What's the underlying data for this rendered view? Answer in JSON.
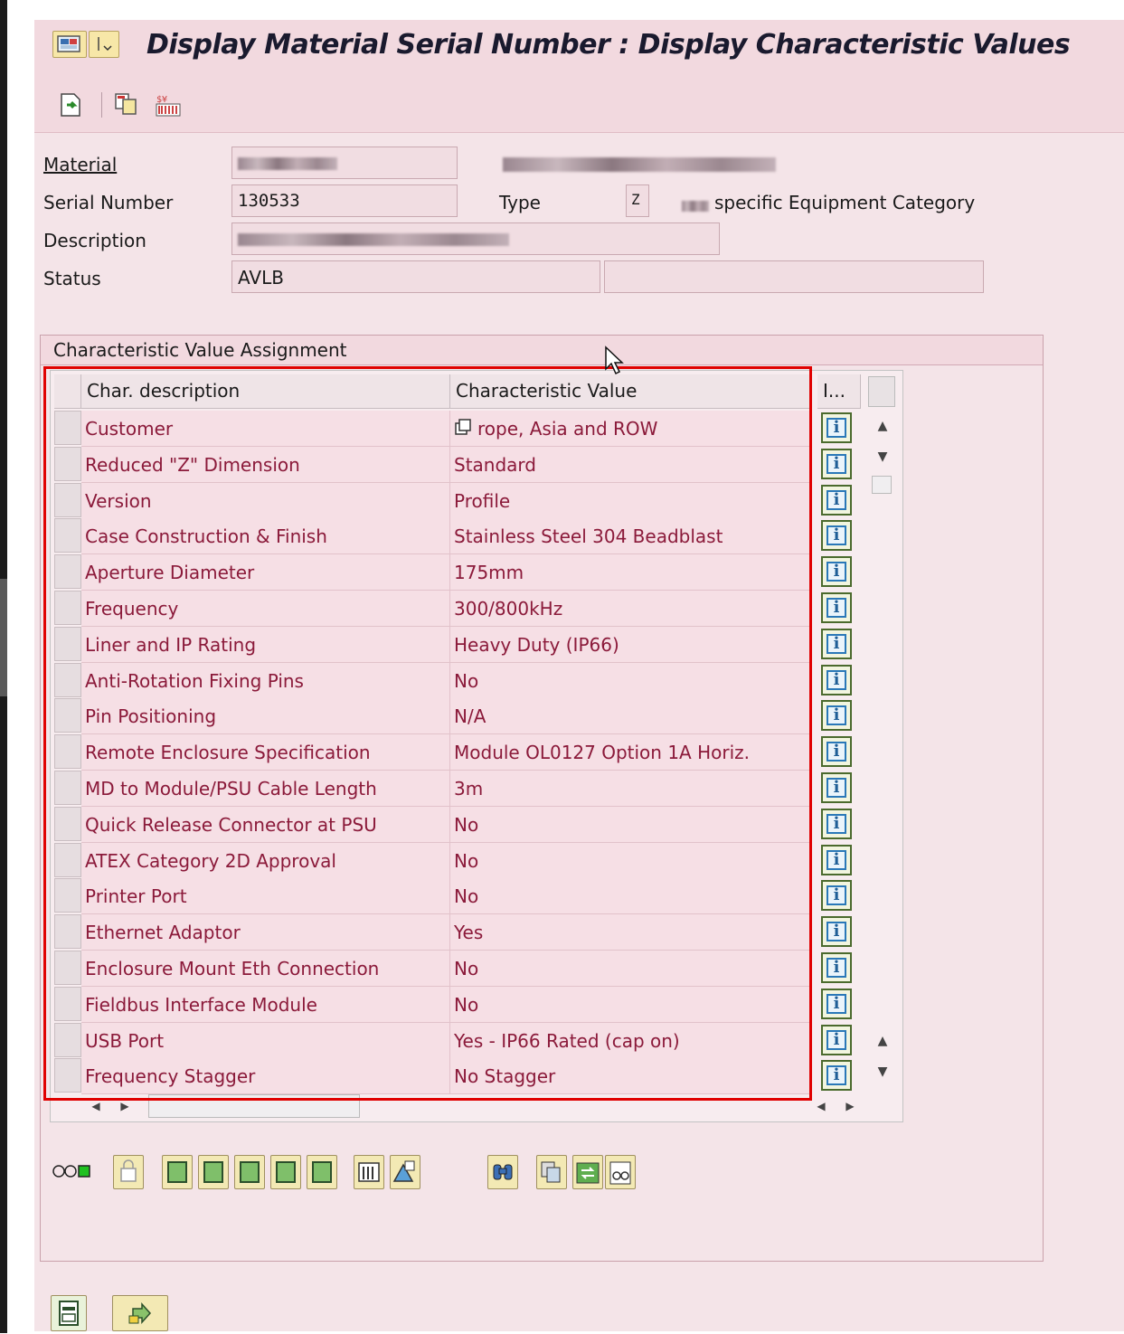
{
  "window": {
    "title": "Display Material Serial Number : Display Characteristic Values"
  },
  "header_fields": {
    "material_label": "Material",
    "serial_label": "Serial Number",
    "serial_value": "130533",
    "type_label": "Type",
    "type_value": "Z",
    "type_text": "specific Equipment Category",
    "description_label": "Description",
    "status_label": "Status",
    "status_value": "AVLB"
  },
  "panel": {
    "title": "Characteristic Value Assignment"
  },
  "table": {
    "columns": [
      "Char. description",
      "Characteristic Value",
      "I..."
    ],
    "rows": [
      {
        "desc": "Customer",
        "value": "rope, Asia and ROW"
      },
      {
        "desc": "Reduced \"Z\" Dimension",
        "value": "Standard"
      },
      {
        "desc": "Version",
        "value": "Profile"
      },
      {
        "desc": "Case Construction & Finish",
        "value": "Stainless Steel 304 Beadblast"
      },
      {
        "desc": "Aperture Diameter",
        "value": "175mm"
      },
      {
        "desc": "Frequency",
        "value": "300/800kHz"
      },
      {
        "desc": "Liner and IP Rating",
        "value": "Heavy Duty (IP66)"
      },
      {
        "desc": "Anti-Rotation Fixing Pins",
        "value": "No"
      },
      {
        "desc": "Pin Positioning",
        "value": "N/A"
      },
      {
        "desc": "Remote Enclosure Specification",
        "value": "Module OL0127 Option 1A Horiz."
      },
      {
        "desc": "MD to Module/PSU Cable Length",
        "value": "3m"
      },
      {
        "desc": "Quick Release Connector at PSU",
        "value": "No"
      },
      {
        "desc": "ATEX Category 2D Approval",
        "value": "No"
      },
      {
        "desc": "Printer Port",
        "value": "No"
      },
      {
        "desc": "Ethernet Adaptor",
        "value": "Yes"
      },
      {
        "desc": "Enclosure Mount Eth Connection",
        "value": "No"
      },
      {
        "desc": "Fieldbus Interface Module",
        "value": "No"
      },
      {
        "desc": "USB Port",
        "value": "Yes - IP66 Rated (cap on)"
      },
      {
        "desc": "Frequency Stagger",
        "value": "No Stagger"
      }
    ],
    "info_glyph": "i"
  },
  "colors": {
    "background": "#f4e4e8",
    "highlight_border": "#e00000",
    "cell_text": "#8b1a3a"
  },
  "icons": [
    "check-icon",
    "copy-icon",
    "barcode-icon",
    "info-icon",
    "binoculars-icon",
    "lock-icon",
    "continue-icon"
  ]
}
